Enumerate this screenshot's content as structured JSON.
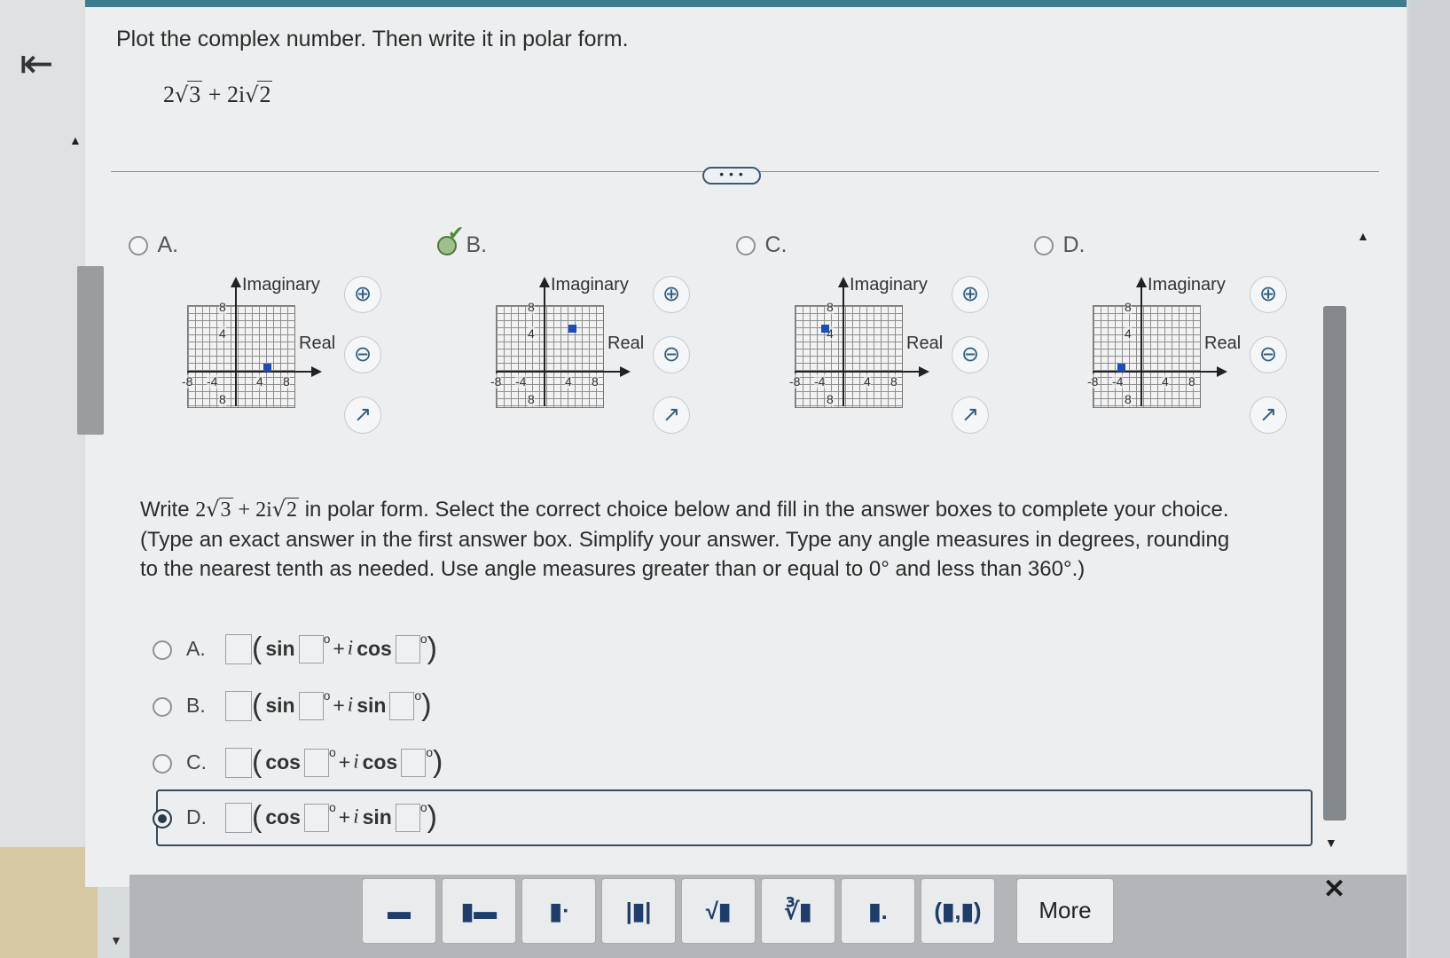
{
  "question": {
    "instruction": "Plot the complex number. Then write it in polar form.",
    "expression_a": "2",
    "expression_a_rad": "3",
    "expression_b": " + 2i",
    "expression_b_rad": "2"
  },
  "divider_handle": "• • •",
  "graph_choices": [
    {
      "label": "A.",
      "imag_label": "Imaginary",
      "real_label": "Real",
      "ticks": {
        "y_top": "8",
        "y_mid": "4",
        "x_neg8": "-8",
        "x_neg4": "-4",
        "x_4": "4",
        "x_8": "8",
        "y_bot": "8"
      }
    },
    {
      "label": "B.",
      "imag_label": "Imaginary",
      "real_label": "Real",
      "ticks": {
        "y_top": "8",
        "y_mid": "4",
        "x_neg8": "-8",
        "x_neg4": "-4",
        "x_4": "4",
        "x_8": "8",
        "y_bot": "8"
      }
    },
    {
      "label": "C.",
      "imag_label": "Imaginary",
      "real_label": "Real",
      "ticks": {
        "y_top": "8",
        "y_mid": "4",
        "x_neg8": "-8",
        "x_neg4": "-4",
        "x_4": "4",
        "x_8": "8",
        "y_bot": "8"
      }
    },
    {
      "label": "D.",
      "imag_label": "Imaginary",
      "real_label": "Real",
      "ticks": {
        "y_top": "8",
        "y_mid": "4",
        "x_neg8": "-8",
        "x_neg4": "-4",
        "x_4": "4",
        "x_8": "8",
        "y_bot": "8"
      }
    }
  ],
  "graph_selected": "B.",
  "polar_prompt": {
    "write": "Write",
    "expr_a": "2",
    "expr_a_rad": "3",
    "expr_b": " + 2i",
    "expr_b_rad": "2",
    "rest": " in polar form. Select the correct choice below and fill in the answer boxes to complete your choice.",
    "hint1": "(Type an exact answer in the first answer box. Simplify your answer. Type any angle measures in degrees, rounding",
    "hint2": "to the nearest tenth as needed. Use angle measures greater than or equal to 0° and less than 360°.)"
  },
  "answers": [
    {
      "label": "A.",
      "f1": "sin",
      "plus": "+",
      "i": "i",
      "f2": "cos"
    },
    {
      "label": "B.",
      "f1": "sin",
      "plus": "+",
      "i": "i",
      "f2": "sin"
    },
    {
      "label": "C.",
      "f1": "cos",
      "plus": "+",
      "i": "i",
      "f2": "cos"
    },
    {
      "label": "D.",
      "f1": "cos",
      "plus": "+",
      "i": "i",
      "f2": "sin"
    }
  ],
  "answer_selected": "D.",
  "toolbar": {
    "more": "More",
    "close": "✕",
    "buttons": [
      "fraction",
      "mixed-number",
      "exponent",
      "absolute-value",
      "square-root",
      "nth-root",
      "decimal",
      "ordered-pair"
    ],
    "pair_text": "(▮,▮)"
  },
  "icons": {
    "zoom_in": "zoom-in-icon",
    "zoom_out": "zoom-out-icon",
    "popout": "popout-icon",
    "back": "back-icon"
  }
}
